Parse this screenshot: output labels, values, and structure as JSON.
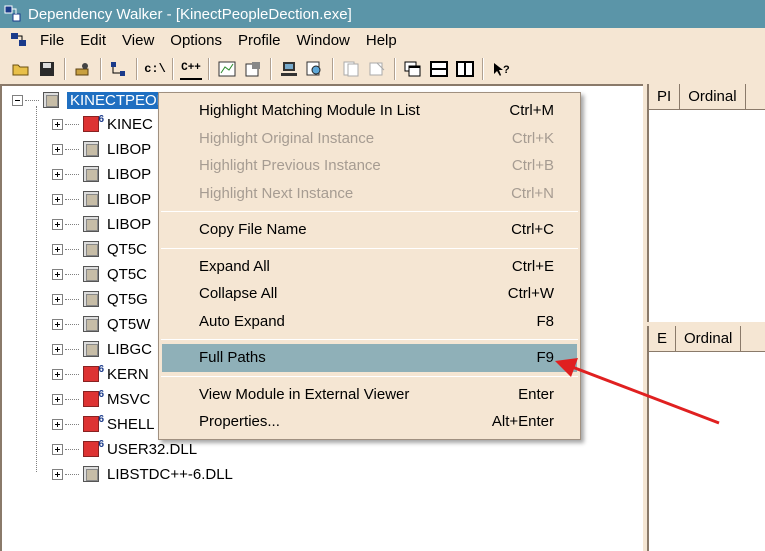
{
  "window": {
    "title": "Dependency Walker - [KinectPeopleDection.exe]"
  },
  "menubar": {
    "items": [
      "File",
      "Edit",
      "View",
      "Options",
      "Profile",
      "Window",
      "Help"
    ]
  },
  "toolbar": {
    "cdir_label": "c:\\",
    "cpp_label": "C++"
  },
  "tree": {
    "root": "KINECTPEOPLEDECTION.EXE",
    "items": [
      {
        "label": "KINEC",
        "icon": "sys"
      },
      {
        "label": "LIBOP",
        "icon": "plain"
      },
      {
        "label": "LIBOP",
        "icon": "plain"
      },
      {
        "label": "LIBOP",
        "icon": "plain"
      },
      {
        "label": "LIBOP",
        "icon": "plain"
      },
      {
        "label": "QT5C",
        "icon": "plain"
      },
      {
        "label": "QT5C",
        "icon": "plain"
      },
      {
        "label": "QT5G",
        "icon": "plain"
      },
      {
        "label": "QT5W",
        "icon": "plain"
      },
      {
        "label": "LIBGC",
        "icon": "plain"
      },
      {
        "label": "KERN",
        "icon": "sys"
      },
      {
        "label": "MSVC",
        "icon": "sys"
      },
      {
        "label": "SHELL",
        "icon": "sys"
      },
      {
        "label": "USER32.DLL",
        "icon": "sys"
      },
      {
        "label": "LIBSTDC++-6.DLL",
        "icon": "plain"
      }
    ]
  },
  "panel_top": {
    "col1": "PI",
    "col2": "Ordinal"
  },
  "panel_bottom": {
    "col1": "E",
    "col2": "Ordinal"
  },
  "context_menu": {
    "groups": [
      [
        {
          "label": "Highlight Matching Module In List",
          "shortcut": "Ctrl+M",
          "enabled": true
        },
        {
          "label": "Highlight Original Instance",
          "shortcut": "Ctrl+K",
          "enabled": false
        },
        {
          "label": "Highlight Previous Instance",
          "shortcut": "Ctrl+B",
          "enabled": false
        },
        {
          "label": "Highlight Next Instance",
          "shortcut": "Ctrl+N",
          "enabled": false
        }
      ],
      [
        {
          "label": "Copy File Name",
          "shortcut": "Ctrl+C",
          "enabled": true
        }
      ],
      [
        {
          "label": "Expand All",
          "shortcut": "Ctrl+E",
          "enabled": true
        },
        {
          "label": "Collapse All",
          "shortcut": "Ctrl+W",
          "enabled": true
        },
        {
          "label": "Auto Expand",
          "shortcut": "F8",
          "enabled": true
        }
      ],
      [
        {
          "label": "Full Paths",
          "shortcut": "F9",
          "enabled": true,
          "highlighted": true
        }
      ],
      [
        {
          "label": "View Module in External Viewer",
          "shortcut": "Enter",
          "enabled": true
        },
        {
          "label": "Properties...",
          "shortcut": "Alt+Enter",
          "enabled": true
        }
      ]
    ]
  },
  "annotation": {
    "arrow_color": "#e02020"
  }
}
